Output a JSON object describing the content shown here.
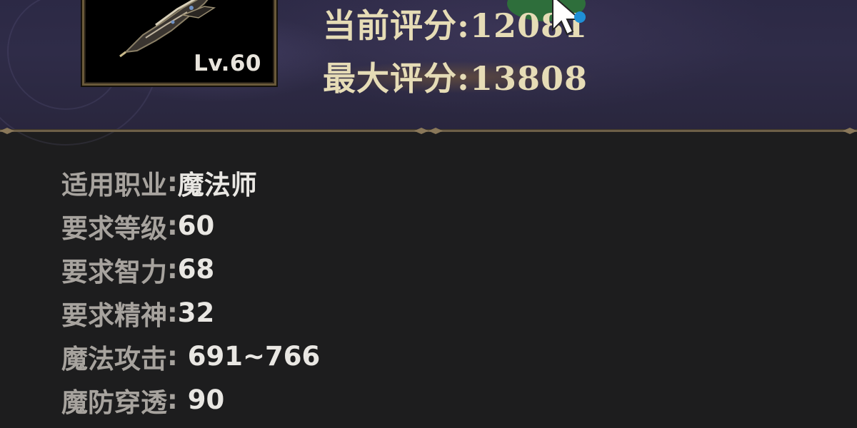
{
  "item": {
    "level_badge": "Lv.60",
    "icon": "weapon-claw-icon"
  },
  "scores": {
    "current_label": "当前评分:",
    "current_value": "12081",
    "max_label": "最大评分:",
    "max_value": "13808"
  },
  "stats": [
    {
      "label": "适用职业",
      "sep": ":",
      "value": "魔法师"
    },
    {
      "label": "要求等级",
      "sep": ":",
      "value": "60"
    },
    {
      "label": "要求智力",
      "sep": ":",
      "value": "68"
    },
    {
      "label": "要求精神",
      "sep": ":",
      "value": "32"
    },
    {
      "label": "魔法攻击",
      "sep": ":",
      "value": "691~766"
    },
    {
      "label": "魔防穿透",
      "sep": ":",
      "value": "90"
    }
  ],
  "colors": {
    "header_bg": "#2e2b47",
    "body_bg": "#1d1d1e",
    "score_text": "#e6dcb6",
    "label_text": "#a7a39e",
    "value_text": "#e9e7e3",
    "frame_border": "#6a5a3a"
  }
}
